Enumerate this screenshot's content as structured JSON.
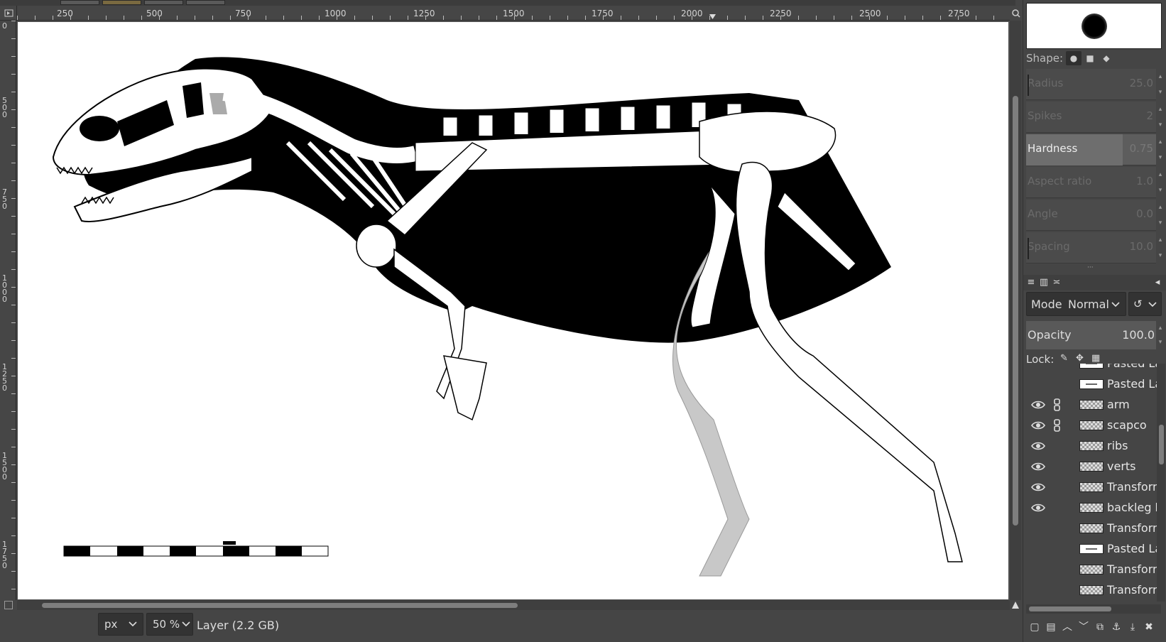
{
  "ruler": {
    "h_labels": [
      "250",
      "500",
      "750",
      "1000",
      "1250",
      "1500",
      "1750",
      "2000",
      "2250",
      "2500",
      "2750"
    ],
    "v_labels": [
      "0",
      "500",
      "750",
      "1000",
      "1250",
      "1500",
      "1750"
    ]
  },
  "status": {
    "unit": "px",
    "zoom": "50 %",
    "info": "Layer (2.2 GB)"
  },
  "tool_options": {
    "shape_label": "Shape:",
    "params": [
      {
        "label": "Radius",
        "value": "25.0"
      },
      {
        "label": "Spikes",
        "value": "2"
      },
      {
        "label": "Hardness",
        "value": "0.75"
      },
      {
        "label": "Aspect ratio",
        "value": "1.0"
      },
      {
        "label": "Angle",
        "value": "0.0"
      },
      {
        "label": "Spacing",
        "value": "10.0"
      }
    ],
    "hardness_level": 0.75
  },
  "layers_panel": {
    "mode_label": "Mode",
    "mode_value": "Normal",
    "opacity_label": "Opacity",
    "opacity_value": "100.0",
    "lock_label": "Lock:",
    "layers": [
      {
        "name": "Pasted La",
        "visible": false,
        "linked": false,
        "thumb": "white"
      },
      {
        "name": "Pasted La",
        "visible": false,
        "linked": false,
        "thumb": "white"
      },
      {
        "name": "arm",
        "visible": true,
        "linked": true,
        "thumb": "checker"
      },
      {
        "name": "scapco",
        "visible": true,
        "linked": true,
        "thumb": "checker"
      },
      {
        "name": "ribs",
        "visible": true,
        "linked": false,
        "thumb": "checker"
      },
      {
        "name": "verts",
        "visible": true,
        "linked": false,
        "thumb": "checker"
      },
      {
        "name": "Transforn",
        "visible": true,
        "linked": false,
        "thumb": "checker"
      },
      {
        "name": "backleg b",
        "visible": true,
        "linked": false,
        "thumb": "checker"
      },
      {
        "name": "Transforn",
        "visible": false,
        "linked": false,
        "thumb": "checker"
      },
      {
        "name": "Pasted La",
        "visible": false,
        "linked": false,
        "thumb": "white"
      },
      {
        "name": "Transforn",
        "visible": false,
        "linked": false,
        "thumb": "checker"
      },
      {
        "name": "Transforn",
        "visible": false,
        "linked": false,
        "thumb": "checker"
      }
    ]
  },
  "icons": {
    "eye": "eye-icon",
    "chain": "chain-icon",
    "dropdown": "chevron-down-icon",
    "reset": "reset-icon"
  }
}
